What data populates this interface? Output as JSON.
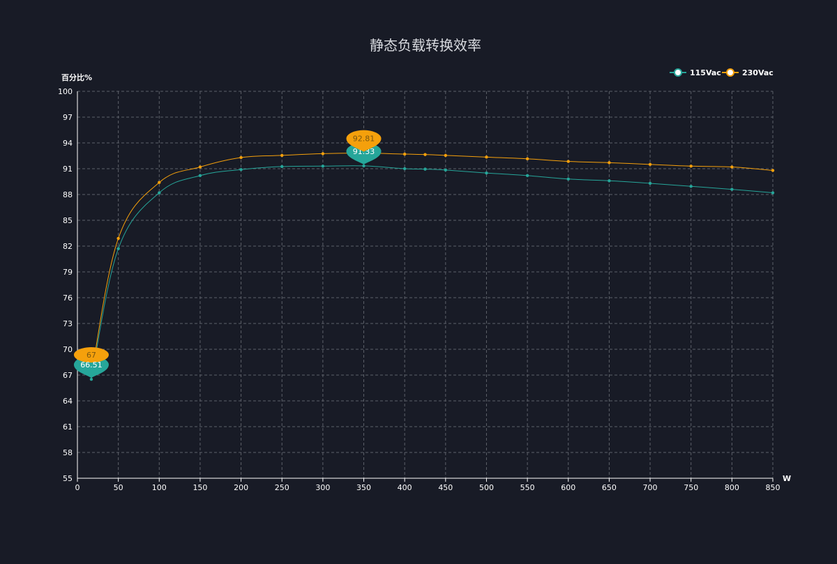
{
  "chart_data": {
    "type": "line",
    "title": "静态负载转换效率",
    "xlabel": "W",
    "ylabel": "百分比%",
    "xlim": [
      0,
      850
    ],
    "ylim": [
      55,
      100
    ],
    "x_ticks": [
      0,
      50,
      100,
      150,
      200,
      250,
      300,
      350,
      400,
      450,
      500,
      550,
      600,
      650,
      700,
      750,
      800,
      850
    ],
    "y_ticks": [
      55,
      58,
      61,
      64,
      67,
      70,
      73,
      76,
      79,
      82,
      85,
      88,
      91,
      94,
      97,
      100
    ],
    "grid": true,
    "legend_position": "top-right",
    "series": [
      {
        "name": "115Vac",
        "color": "#26a69a",
        "points": [
          [
            17,
            66.51
          ],
          [
            50,
            81.7
          ],
          [
            100,
            88.2
          ],
          [
            150,
            90.2
          ],
          [
            200,
            90.9
          ],
          [
            250,
            91.25
          ],
          [
            300,
            91.3
          ],
          [
            350,
            91.33
          ],
          [
            400,
            91.0
          ],
          [
            425,
            90.95
          ],
          [
            450,
            90.85
          ],
          [
            500,
            90.5
          ],
          [
            550,
            90.2
          ],
          [
            600,
            89.8
          ],
          [
            650,
            89.6
          ],
          [
            700,
            89.3
          ],
          [
            750,
            88.95
          ],
          [
            800,
            88.6
          ],
          [
            850,
            88.2
          ]
        ],
        "max_label": {
          "x": 350,
          "y": 91.33,
          "text": "91.33"
        },
        "min_label": {
          "x": 17,
          "y": 66.51,
          "text": "66.51"
        }
      },
      {
        "name": "230Vac",
        "color": "#f5a00c",
        "points": [
          [
            17,
            67
          ],
          [
            50,
            82.9
          ],
          [
            100,
            89.4
          ],
          [
            150,
            91.2
          ],
          [
            200,
            92.3
          ],
          [
            250,
            92.55
          ],
          [
            300,
            92.75
          ],
          [
            350,
            92.81
          ],
          [
            400,
            92.7
          ],
          [
            425,
            92.65
          ],
          [
            450,
            92.55
          ],
          [
            500,
            92.35
          ],
          [
            550,
            92.15
          ],
          [
            600,
            91.85
          ],
          [
            650,
            91.7
          ],
          [
            700,
            91.5
          ],
          [
            750,
            91.3
          ],
          [
            800,
            91.2
          ],
          [
            850,
            90.8
          ]
        ],
        "max_label": {
          "x": 350,
          "y": 92.81,
          "text": "92.81"
        },
        "min_label": {
          "x": 17,
          "y": 67,
          "text": "67"
        }
      }
    ]
  }
}
